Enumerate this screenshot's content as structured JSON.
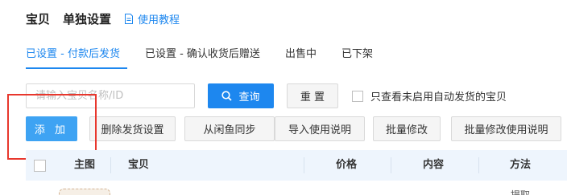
{
  "header": {
    "title": "宝贝",
    "subtitle": "单独设置",
    "help_link": "使用教程"
  },
  "tabs": [
    {
      "label": "已设置 - 付款后发货",
      "active": true
    },
    {
      "label": "已设置 - 确认收货后赠送",
      "active": false
    },
    {
      "label": "出售中",
      "active": false
    },
    {
      "label": "已下架",
      "active": false
    }
  ],
  "search": {
    "placeholder": "请输入宝贝名称/ID",
    "query_label": "查询",
    "reset_label": "重 置",
    "filter_label": "只查看未启用自动发货的宝贝"
  },
  "actions": {
    "add": "添 加",
    "delete": "删除发货设置",
    "sync": "从闲鱼同步",
    "import": "导入使用说明",
    "batch_edit": "批量修改",
    "batch_edit_instructions": "批量修改使用说明"
  },
  "table": {
    "columns": [
      "主图",
      "宝贝",
      "价格",
      "内容",
      "方法"
    ],
    "row_method_partial": "提取"
  },
  "colors": {
    "accent": "#1d87ef",
    "add_button": "#3ea3f3",
    "highlight_box": "#e8372d",
    "table_header_bg": "#eef5fd"
  }
}
